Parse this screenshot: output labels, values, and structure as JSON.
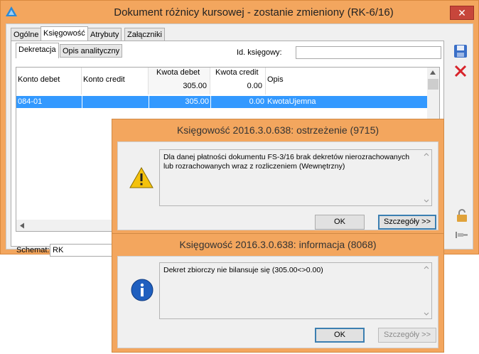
{
  "window": {
    "title": "Dokument różnicy kursowej - zostanie zmieniony  (RK-6/16)",
    "close_glyph": "✕"
  },
  "tabs": [
    "Ogólne",
    "Księgowość",
    "Atrybuty",
    "Załączniki"
  ],
  "subtabs": [
    "Dekretacja",
    "Opis analityczny"
  ],
  "id_label": "Id. księgowy:",
  "id_value": "",
  "grid": {
    "headers": {
      "konto_debet": "Konto debet",
      "konto_credit": "Konto credit",
      "kwota_debet": "Kwota debet",
      "kwota_credit": "Kwota credit",
      "opis": "Opis"
    },
    "totals": {
      "debet": "305.00",
      "credit": "0.00"
    },
    "rows": [
      {
        "konto_debet": "084-01",
        "konto_credit": "",
        "kwota_debet": "305.00",
        "kwota_credit": "0.00",
        "opis": "KwotaUjemna"
      }
    ]
  },
  "schemat_label": "Schemat:",
  "schemat_value": "RK",
  "dialog_warning": {
    "title": "Księgowość 2016.3.0.638: ostrzeżenie (9715)",
    "message": "Dla danej płatności dokumentu FS-3/16 brak dekretów nierozrachowanych lub rozrachowanych wraz z rozliczeniem (Wewnętrzny)",
    "ok": "OK",
    "details": "Szczegóły >>"
  },
  "dialog_info": {
    "title": "Księgowość 2016.3.0.638: informacja (8068)",
    "message": "Dekret zbiorczy  nie bilansuje się (305.00<>0.00)",
    "ok": "OK",
    "details": "Szczegóły >>"
  },
  "colors": {
    "title_bar": "#f3a65e",
    "selection": "#3399ff",
    "close": "#c7463b"
  }
}
